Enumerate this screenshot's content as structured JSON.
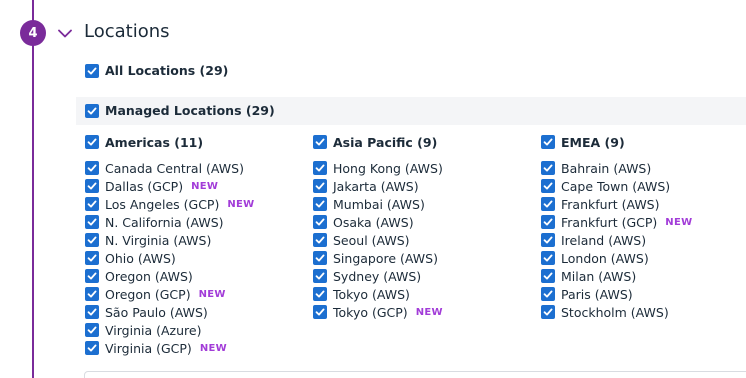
{
  "step": {
    "number": "4",
    "title": "Locations"
  },
  "icons": {
    "chevron": "chevron-down-icon",
    "check": "checkmark-icon"
  },
  "colors": {
    "accent": "#7a2b9a",
    "checkbox": "#1c6fd0",
    "new_tag": "#a23cd8"
  },
  "all_locations": {
    "label": "All Locations (29)",
    "checked": true
  },
  "managed_locations": {
    "label": "Managed Locations (29)",
    "checked": true
  },
  "new_label": "NEW",
  "regions": [
    {
      "label": "Americas (11)",
      "checked": true,
      "items": [
        {
          "label": "Canada Central (AWS)",
          "checked": true,
          "new": false
        },
        {
          "label": "Dallas (GCP)",
          "checked": true,
          "new": true
        },
        {
          "label": "Los Angeles (GCP)",
          "checked": true,
          "new": true
        },
        {
          "label": "N. California (AWS)",
          "checked": true,
          "new": false
        },
        {
          "label": "N. Virginia (AWS)",
          "checked": true,
          "new": false
        },
        {
          "label": "Ohio (AWS)",
          "checked": true,
          "new": false
        },
        {
          "label": "Oregon (AWS)",
          "checked": true,
          "new": false
        },
        {
          "label": "Oregon (GCP)",
          "checked": true,
          "new": true
        },
        {
          "label": "São Paulo (AWS)",
          "checked": true,
          "new": false
        },
        {
          "label": "Virginia (Azure)",
          "checked": true,
          "new": false
        },
        {
          "label": "Virginia (GCP)",
          "checked": true,
          "new": true
        }
      ]
    },
    {
      "label": "Asia Pacific (9)",
      "checked": true,
      "items": [
        {
          "label": "Hong Kong (AWS)",
          "checked": true,
          "new": false
        },
        {
          "label": "Jakarta (AWS)",
          "checked": true,
          "new": false
        },
        {
          "label": "Mumbai (AWS)",
          "checked": true,
          "new": false
        },
        {
          "label": "Osaka (AWS)",
          "checked": true,
          "new": false
        },
        {
          "label": "Seoul (AWS)",
          "checked": true,
          "new": false
        },
        {
          "label": "Singapore (AWS)",
          "checked": true,
          "new": false
        },
        {
          "label": "Sydney (AWS)",
          "checked": true,
          "new": false
        },
        {
          "label": "Tokyo (AWS)",
          "checked": true,
          "new": false
        },
        {
          "label": "Tokyo (GCP)",
          "checked": true,
          "new": true
        }
      ]
    },
    {
      "label": "EMEA (9)",
      "checked": true,
      "items": [
        {
          "label": "Bahrain (AWS)",
          "checked": true,
          "new": false
        },
        {
          "label": "Cape Town (AWS)",
          "checked": true,
          "new": false
        },
        {
          "label": "Frankfurt (AWS)",
          "checked": true,
          "new": false
        },
        {
          "label": "Frankfurt (GCP)",
          "checked": true,
          "new": true
        },
        {
          "label": "Ireland (AWS)",
          "checked": true,
          "new": false
        },
        {
          "label": "London (AWS)",
          "checked": true,
          "new": false
        },
        {
          "label": "Milan (AWS)",
          "checked": true,
          "new": false
        },
        {
          "label": "Paris (AWS)",
          "checked": true,
          "new": false
        },
        {
          "label": "Stockholm (AWS)",
          "checked": true,
          "new": false
        }
      ]
    }
  ]
}
